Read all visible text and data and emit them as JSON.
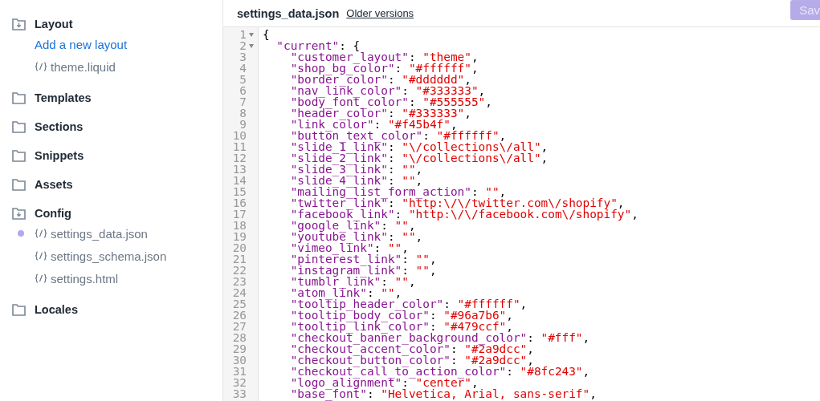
{
  "sidebar": {
    "sections": [
      {
        "name": "Layout",
        "expanded": true,
        "items": [
          {
            "kind": "link",
            "label": "Add a new layout",
            "modified": false
          },
          {
            "kind": "file",
            "label": "theme.liquid",
            "modified": false
          }
        ]
      },
      {
        "name": "Templates",
        "expanded": false
      },
      {
        "name": "Sections",
        "expanded": false
      },
      {
        "name": "Snippets",
        "expanded": false
      },
      {
        "name": "Assets",
        "expanded": false
      },
      {
        "name": "Config",
        "expanded": true,
        "items": [
          {
            "kind": "file",
            "label": "settings_data.json",
            "modified": true
          },
          {
            "kind": "file",
            "label": "settings_schema.json",
            "modified": false
          },
          {
            "kind": "file",
            "label": "settings.html",
            "modified": false
          }
        ]
      },
      {
        "name": "Locales",
        "expanded": false
      }
    ]
  },
  "editor": {
    "filename": "settings_data.json",
    "versions_link": "Older versions",
    "save_button": {
      "label": "Sav",
      "disabled": true
    },
    "lines": [
      {
        "number": "1",
        "fold": true,
        "text": "{",
        "children": [
          {
            "number": "2",
            "fold": true,
            "key": "\"current\"",
            "sep": ": {",
            "children": [
              {
                "number": "3",
                "key": "\"customer_layout\"",
                "sep": ": ",
                "value": "\"theme\"",
                "end": ","
              },
              {
                "number": "4",
                "key": "\"shop_bg_color\"",
                "sep": ": ",
                "value": "\"#ffffff\"",
                "end": ","
              },
              {
                "number": "5",
                "key": "\"border_color\"",
                "sep": ": ",
                "value": "\"#dddddd\"",
                "end": ","
              },
              {
                "number": "6",
                "key": "\"nav_link_color\"",
                "sep": ": ",
                "value": "\"#333333\"",
                "end": ","
              },
              {
                "number": "7",
                "key": "\"body_font_color\"",
                "sep": ": ",
                "value": "\"#555555\"",
                "end": ","
              },
              {
                "number": "8",
                "key": "\"header_color\"",
                "sep": ": ",
                "value": "\"#333333\"",
                "end": ","
              },
              {
                "number": "9",
                "key": "\"link_color\"",
                "sep": ": ",
                "value": "\"#f45b4f\"",
                "end": ","
              },
              {
                "number": "10",
                "key": "\"button_text_color\"",
                "sep": ": ",
                "value": "\"#ffffff\"",
                "end": ","
              },
              {
                "number": "11",
                "key": "\"slide_1_link\"",
                "sep": ": ",
                "value": "\"\\/collections\\/all\"",
                "end": ","
              },
              {
                "number": "12",
                "key": "\"slide_2_link\"",
                "sep": ": ",
                "value": "\"\\/collections\\/all\"",
                "end": ","
              },
              {
                "number": "13",
                "key": "\"slide_3_link\"",
                "sep": ": ",
                "value": "\"\"",
                "end": ","
              },
              {
                "number": "14",
                "key": "\"slide_4_link\"",
                "sep": ": ",
                "value": "\"\"",
                "end": ","
              },
              {
                "number": "15",
                "key": "\"mailing_list_form_action\"",
                "sep": ": ",
                "value": "\"\"",
                "end": ","
              },
              {
                "number": "16",
                "key": "\"twitter_link\"",
                "sep": ": ",
                "value": "\"http:\\/\\/twitter.com\\/shopify\"",
                "end": ","
              },
              {
                "number": "17",
                "key": "\"facebook_link\"",
                "sep": ": ",
                "value": "\"http:\\/\\/facebook.com\\/shopify\"",
                "end": ","
              },
              {
                "number": "18",
                "key": "\"google_link\"",
                "sep": ": ",
                "value": "\"\"",
                "end": ","
              },
              {
                "number": "19",
                "key": "\"youtube_link\"",
                "sep": ": ",
                "value": "\"\"",
                "end": ","
              },
              {
                "number": "20",
                "key": "\"vimeo_link\"",
                "sep": ": ",
                "value": "\"\"",
                "end": ","
              },
              {
                "number": "21",
                "key": "\"pinterest_link\"",
                "sep": ": ",
                "value": "\"\"",
                "end": ","
              },
              {
                "number": "22",
                "key": "\"instagram_link\"",
                "sep": ": ",
                "value": "\"\"",
                "end": ","
              },
              {
                "number": "23",
                "key": "\"tumblr_link\"",
                "sep": ": ",
                "value": "\"\"",
                "end": ","
              },
              {
                "number": "24",
                "key": "\"atom_link\"",
                "sep": ": ",
                "value": "\"\"",
                "end": ","
              },
              {
                "number": "25",
                "key": "\"tooltip_header_color\"",
                "sep": ": ",
                "value": "\"#ffffff\"",
                "end": ","
              },
              {
                "number": "26",
                "key": "\"tooltip_body_color\"",
                "sep": ": ",
                "value": "\"#96a7b6\"",
                "end": ","
              },
              {
                "number": "27",
                "key": "\"tooltip_link_color\"",
                "sep": ": ",
                "value": "\"#479ccf\"",
                "end": ","
              },
              {
                "number": "28",
                "key": "\"checkout_banner_background_color\"",
                "sep": ": ",
                "value": "\"#fff\"",
                "end": ","
              },
              {
                "number": "29",
                "key": "\"checkout_accent_color\"",
                "sep": ": ",
                "value": "\"#2a9dcc\"",
                "end": ","
              },
              {
                "number": "30",
                "key": "\"checkout_button_color\"",
                "sep": ": ",
                "value": "\"#2a9dcc\"",
                "end": ","
              },
              {
                "number": "31",
                "key": "\"checkout_call_to_action_color\"",
                "sep": ": ",
                "value": "\"#8fc243\"",
                "end": ","
              },
              {
                "number": "32",
                "key": "\"logo_alignment\"",
                "sep": ": ",
                "value": "\"center\"",
                "end": ","
              },
              {
                "number": "33",
                "key": "\"base_font\"",
                "sep": ": ",
                "value": "\"Helvetica, Arial, sans-serif\"",
                "end": ","
              }
            ]
          }
        ]
      }
    ]
  }
}
